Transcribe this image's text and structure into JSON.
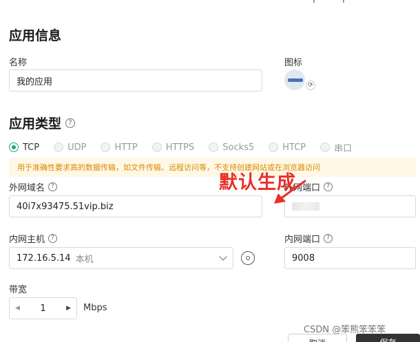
{
  "app_info": {
    "title": "应用信息",
    "name_label": "名称",
    "name_value": "我的应用",
    "icon_label": "图标",
    "icon_name": "app-logo-icon"
  },
  "app_type": {
    "title": "应用类型",
    "help_symbol": "?",
    "options": [
      {
        "label": "TCP",
        "checked": true,
        "disabled": false
      },
      {
        "label": "UDP",
        "checked": false,
        "disabled": true
      },
      {
        "label": "HTTP",
        "checked": false,
        "disabled": true
      },
      {
        "label": "HTTPS",
        "checked": false,
        "disabled": true
      },
      {
        "label": "Socks5",
        "checked": false,
        "disabled": true
      },
      {
        "label": "HTCP",
        "checked": false,
        "disabled": true
      },
      {
        "label": "串口",
        "checked": false,
        "disabled": true
      }
    ],
    "notice": "用于准确性要求高的数据传输，如文件传输、远程访问等，不支持创建网站或在浏览器访问"
  },
  "fields": {
    "external_domain_label": "外网域名",
    "external_domain_value": "40i7x93475.51vip.biz",
    "external_port_label": "外网端口",
    "internal_host_label": "内网主机",
    "internal_host_value": "172.16.5.14",
    "internal_host_sub": "本机",
    "internal_port_label": "内网端口",
    "internal_port_value": "9008",
    "bandwidth_label": "带宽",
    "bandwidth_value": "1",
    "bandwidth_unit": "Mbps",
    "stepper_down": "◀",
    "stepper_up": "▶"
  },
  "annotation": {
    "text": "默认生成",
    "color": "#e8302a"
  },
  "footer": {
    "watermark": "CSDN @笨熊笨笨笨",
    "cancel_label": "取消",
    "save_label": "保存"
  },
  "colors": {
    "accent": "#1aa87a",
    "notice_bg": "#fff8e6",
    "notice_text": "#d98a00"
  }
}
